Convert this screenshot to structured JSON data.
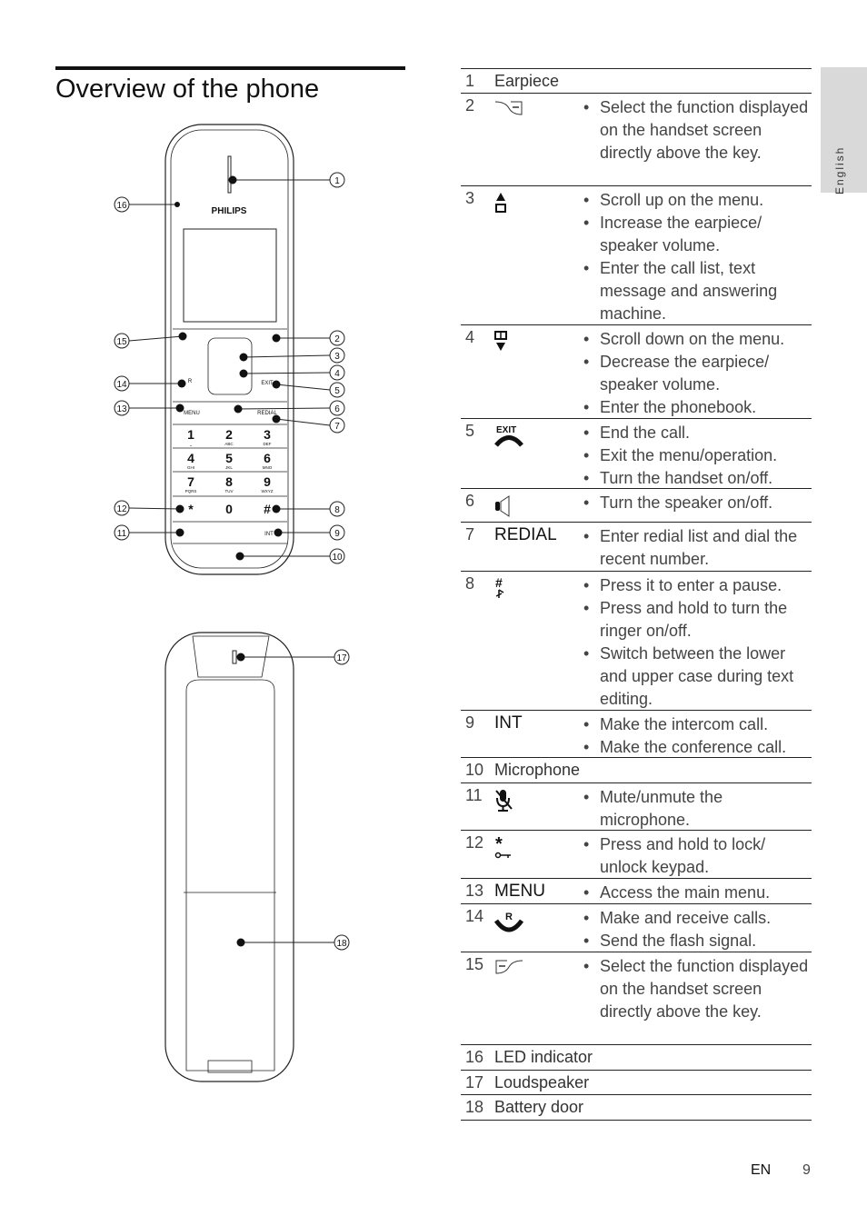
{
  "page_title": "Overview of the phone",
  "language_tab": "English",
  "brand": "PHILIPS",
  "keypad": {
    "keys": [
      [
        "1",
        "2",
        "3"
      ],
      [
        "4",
        "5",
        "6"
      ],
      [
        "7",
        "8",
        "9"
      ],
      [
        "*",
        "0",
        "#"
      ]
    ],
    "subs": [
      [
        "⎵",
        "ABC",
        "DEF"
      ],
      [
        "GHI",
        "JKL",
        "MNO"
      ],
      [
        "PQRS",
        "TUV",
        "WXYZ"
      ],
      [
        "",
        "",
        ""
      ]
    ],
    "menu": "MENU",
    "redial": "REDIAL",
    "exit": "EXIT",
    "int": "INT",
    "r": "R"
  },
  "callouts": [
    "1",
    "2",
    "3",
    "4",
    "5",
    "6",
    "7",
    "8",
    "9",
    "10",
    "11",
    "12",
    "13",
    "14",
    "15",
    "16",
    "17",
    "18"
  ],
  "table": [
    {
      "num": "1",
      "label": "Earpiece",
      "bullets": []
    },
    {
      "num": "2",
      "icon": "right-softkey-icon",
      "bullets": [
        "Select the function displayed on the handset screen directly above the key."
      ]
    },
    {
      "num": "3",
      "icon": "up-arrow-call-list-icon",
      "bullets": [
        "Scroll up on the menu.",
        "Increase the earpiece/ speaker volume.",
        "Enter the call list, text message and answering machine."
      ]
    },
    {
      "num": "4",
      "icon": "phonebook-down-arrow-icon",
      "bullets": [
        "Scroll down on the menu.",
        "Decrease the earpiece/ speaker volume.",
        "Enter the phonebook."
      ]
    },
    {
      "num": "5",
      "icon": "exit-end-call-icon",
      "icon_text": "EXIT",
      "bullets": [
        "End the call.",
        "Exit the menu/operation.",
        "Turn the handset on/off."
      ]
    },
    {
      "num": "6",
      "icon": "speaker-icon",
      "bullets": [
        "Turn the speaker on/off."
      ]
    },
    {
      "num": "7",
      "label": "REDIAL",
      "bold": true,
      "bullets": [
        "Enter redial list and dial the recent number."
      ]
    },
    {
      "num": "8",
      "icon": "hash-ringer-icon",
      "bullets": [
        "Press it to enter a pause.",
        "Press and hold to turn the ringer on/off.",
        "Switch between the lower and upper case during text editing."
      ]
    },
    {
      "num": "9",
      "label": "INT",
      "bold": true,
      "bullets": [
        "Make the intercom call.",
        "Make the conference call."
      ]
    },
    {
      "num": "10",
      "label": "Microphone",
      "bullets": []
    },
    {
      "num": "11",
      "icon": "mute-microphone-icon",
      "bullets": [
        "Mute/unmute the microphone."
      ]
    },
    {
      "num": "12",
      "icon": "star-keylock-icon",
      "bullets": [
        "Press and hold to lock/ unlock keypad."
      ]
    },
    {
      "num": "13",
      "label": "MENU",
      "bold": true,
      "bullets": [
        "Access the main menu."
      ]
    },
    {
      "num": "14",
      "icon": "talk-flash-icon",
      "icon_text": "R",
      "bullets": [
        "Make and receive calls.",
        "Send the flash signal."
      ]
    },
    {
      "num": "15",
      "icon": "left-softkey-icon",
      "bullets": [
        "Select the function displayed on the handset screen directly above the key."
      ]
    },
    {
      "num": "16",
      "label": "LED indicator",
      "bullets": []
    },
    {
      "num": "17",
      "label": "Loudspeaker",
      "bullets": []
    },
    {
      "num": "18",
      "label": "Battery door",
      "bullets": []
    }
  ],
  "footer": {
    "lang": "EN",
    "page": "9"
  }
}
